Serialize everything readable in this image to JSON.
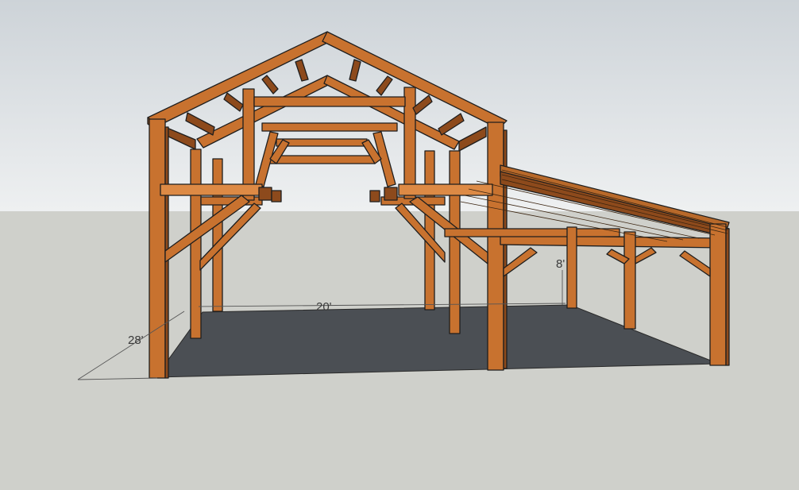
{
  "scene": {
    "sky_top": "#cdd3d8",
    "sky_bottom": "#eef0f1",
    "ground": "#cfd0cb",
    "slab": "#4b4f54",
    "timber": "#c8722f",
    "timber_dark": "#8d4a1c",
    "timber_light": "#dd8a45",
    "outline": "#1e1e1e",
    "dimension_line": "#555555"
  },
  "dimensions": {
    "width_label": "20'",
    "depth_label": "28'",
    "lean_to_height_label": "8'"
  }
}
